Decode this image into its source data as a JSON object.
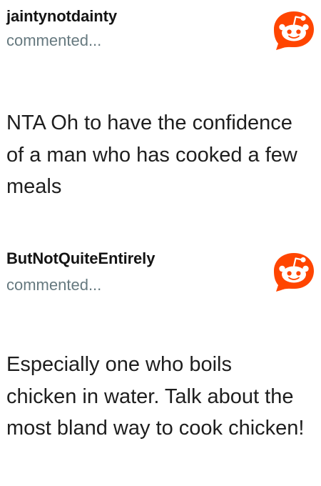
{
  "comments": [
    {
      "username": "jaintynotdainty",
      "action": "commented...",
      "avatar_icon": "reddit-snoo-icon",
      "text": "NTA Oh to have the confidence of a man who has cooked a few meals"
    },
    {
      "username": "ButNotQuiteEntirely",
      "action": "commented...",
      "avatar_icon": "reddit-snoo-icon",
      "text": "Especially one who boils chicken in water. Talk about the most bland way to cook chicken!"
    }
  ],
  "colors": {
    "brand": "#ff4500",
    "username": "#141414",
    "meta": "#66797f",
    "text": "#1e1e1e"
  }
}
